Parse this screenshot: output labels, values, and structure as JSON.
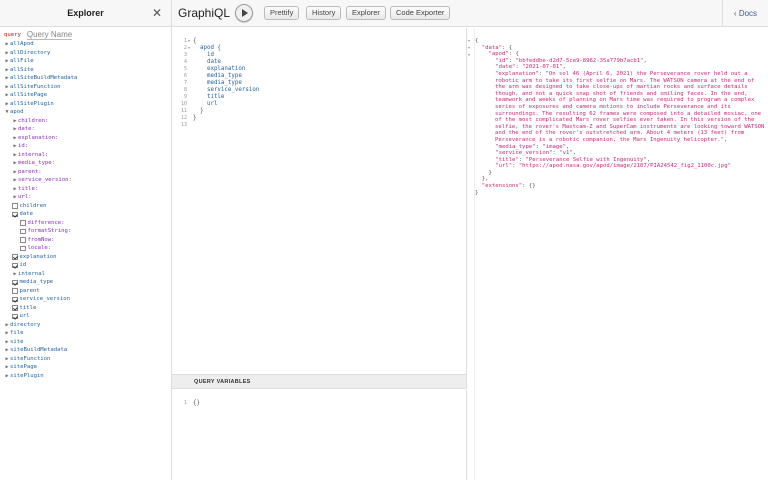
{
  "explorer": {
    "title": "Explorer",
    "close_glyph": "✕",
    "query_keyword": "query",
    "query_name_placeholder": "Query Name",
    "tree": [
      {
        "label": "allApod",
        "kind": "root",
        "expanded": false
      },
      {
        "label": "allDirectory",
        "kind": "root",
        "expanded": false
      },
      {
        "label": "allFile",
        "kind": "root",
        "expanded": false
      },
      {
        "label": "allSite",
        "kind": "root",
        "expanded": false
      },
      {
        "label": "allSiteBuildMetadata",
        "kind": "root",
        "expanded": false
      },
      {
        "label": "allSiteFunction",
        "kind": "root",
        "expanded": false
      },
      {
        "label": "allSitePage",
        "kind": "root",
        "expanded": false
      },
      {
        "label": "allSitePlugin",
        "kind": "root",
        "expanded": false
      },
      {
        "label": "apod",
        "kind": "root",
        "expanded": true
      },
      {
        "label": "children:",
        "kind": "arg",
        "indent": 1
      },
      {
        "label": "date:",
        "kind": "arg",
        "indent": 1
      },
      {
        "label": "explanation:",
        "kind": "arg",
        "indent": 1
      },
      {
        "label": "id:",
        "kind": "arg",
        "indent": 1
      },
      {
        "label": "internal:",
        "kind": "arg",
        "indent": 1
      },
      {
        "label": "media_type:",
        "kind": "arg",
        "indent": 1
      },
      {
        "label": "parent:",
        "kind": "arg",
        "indent": 1
      },
      {
        "label": "service_version:",
        "kind": "arg",
        "indent": 1
      },
      {
        "label": "title:",
        "kind": "arg",
        "indent": 1
      },
      {
        "label": "url:",
        "kind": "arg",
        "indent": 1
      },
      {
        "label": "children",
        "kind": "field",
        "indent": 1,
        "checked": false
      },
      {
        "label": "date",
        "kind": "field",
        "indent": 1,
        "checked": true
      },
      {
        "label": "difference:",
        "kind": "subarg",
        "indent": 2,
        "checked": false
      },
      {
        "label": "formatString:",
        "kind": "subarg",
        "indent": 2,
        "checked": false
      },
      {
        "label": "fromNow:",
        "kind": "subarg",
        "indent": 2,
        "checked": false
      },
      {
        "label": "locale:",
        "kind": "subarg",
        "indent": 2,
        "checked": false
      },
      {
        "label": "explanation",
        "kind": "field",
        "indent": 1,
        "checked": true
      },
      {
        "label": "id",
        "kind": "field",
        "indent": 1,
        "checked": true
      },
      {
        "label": "internal",
        "kind": "object",
        "indent": 1
      },
      {
        "label": "media_type",
        "kind": "field",
        "indent": 1,
        "checked": true
      },
      {
        "label": "parent",
        "kind": "field",
        "indent": 1,
        "checked": false
      },
      {
        "label": "service_version",
        "kind": "field",
        "indent": 1,
        "checked": true
      },
      {
        "label": "title",
        "kind": "field",
        "indent": 1,
        "checked": true
      },
      {
        "label": "url",
        "kind": "field",
        "indent": 1,
        "checked": true
      },
      {
        "label": "directory",
        "kind": "root",
        "expanded": false
      },
      {
        "label": "file",
        "kind": "root",
        "expanded": false
      },
      {
        "label": "site",
        "kind": "root",
        "expanded": false
      },
      {
        "label": "siteBuildMetadata",
        "kind": "root",
        "expanded": false
      },
      {
        "label": "siteFunction",
        "kind": "root",
        "expanded": false
      },
      {
        "label": "sitePage",
        "kind": "root",
        "expanded": false
      },
      {
        "label": "sitePlugin",
        "kind": "root",
        "expanded": false
      }
    ]
  },
  "toolbar": {
    "title": "GraphiQL",
    "prettify_label": "Prettify",
    "history_label": "History",
    "explorer_label": "Explorer",
    "code_exporter_label": "Code Exporter",
    "docs_label": "Docs"
  },
  "query_editor": {
    "line_numbers": [
      "1",
      "2",
      "3",
      "4",
      "5",
      "6",
      "7",
      "8",
      "9",
      "10",
      "11",
      "12",
      "13"
    ],
    "lines": [
      {
        "text": "{",
        "cls": "punc"
      },
      {
        "text": "  apod {",
        "cls": "qf"
      },
      {
        "text": "    id",
        "cls": "qf"
      },
      {
        "text": "    date",
        "cls": "qf"
      },
      {
        "text": "    explanation",
        "cls": "qf"
      },
      {
        "text": "    media_type",
        "cls": "qf"
      },
      {
        "text": "    media_type",
        "cls": "qf"
      },
      {
        "text": "    service_version",
        "cls": "qf"
      },
      {
        "text": "    title",
        "cls": "qf"
      },
      {
        "text": "    url",
        "cls": "qf"
      },
      {
        "text": "  }",
        "cls": "punc"
      },
      {
        "text": "}",
        "cls": "punc"
      },
      {
        "text": "",
        "cls": "punc"
      }
    ]
  },
  "variables": {
    "header": "QUERY VARIABLES",
    "line_number": "1",
    "content": "{}"
  },
  "result": {
    "open_brace": "{",
    "data_key": "\"data\"",
    "apod_key": "\"apod\"",
    "id_key": "\"id\"",
    "id_value": "\"bbfeddbe-d2d7-5ce9-8962-35a779b7acb1\"",
    "date_key": "\"date\"",
    "date_value": "\"2021-07-01\"",
    "explanation_key": "\"explanation\"",
    "explanation_value": "\"On sol 46 (April 6, 2021) the Perseverance rover held out a robotic arm to take its first selfie on Mars. The WATSON camera at the end of the arm was designed to take close-ups of martian rocks and surface details though, and not a quick snap shot of friends and smiling faces. In the end, teamwork and weeks of planning on Mars time was required to program a complex series of exposures and camera motions to include Perseverance and its surroundings. The resulting 62 frames were composed into a detailed mosiac, one of the most complicated Mars rover selfies ever taken. In this version of the selfie, the rover's Mastcam-Z and SuperCam instruments are looking toward WATSON and the end of the rover's outstretched arm. About 4 meters (13 feet) from Perseverance is a robotic companion, the Mars Ingenuity helicopter.\"",
    "media_type_key": "\"media_type\"",
    "media_type_value": "\"image\"",
    "service_version_key": "\"service_version\"",
    "service_version_value": "\"v1\"",
    "title_key": "\"title\"",
    "title_value": "\"Perseverance Selfie with Ingenuity\"",
    "url_key": "\"url\"",
    "url_value": "\"https://apod.nasa.gov/apod/image/2107/PIA24542_fig2_1100c.jpg\"",
    "extensions_key": "\"extensions\"",
    "extensions_value": "{}"
  }
}
